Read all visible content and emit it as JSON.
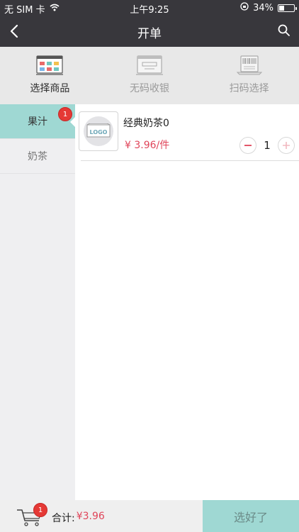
{
  "status_bar": {
    "carrier": "无 SIM 卡",
    "time": "上午9:25",
    "battery": "34%",
    "battery_level": 0.34
  },
  "nav": {
    "title": "开单"
  },
  "modes": [
    {
      "label": "选择商品",
      "icon": "product-grid-icon",
      "active": true
    },
    {
      "label": "无码收银",
      "icon": "cash-register-icon",
      "active": false
    },
    {
      "label": "扫码选择",
      "icon": "barcode-scanner-icon",
      "active": false
    }
  ],
  "categories": [
    {
      "label": "果汁",
      "badge": "1",
      "active": true
    },
    {
      "label": "奶茶",
      "badge": "",
      "active": false
    }
  ],
  "products": [
    {
      "name": "经典奶茶0",
      "price": "¥ 3.96/件",
      "quantity": "1",
      "image_text": "LOGO"
    }
  ],
  "bottom_bar": {
    "cart_badge": "1",
    "total_label": "合计:",
    "total_amount": "¥3.96",
    "confirm_label": "选好了"
  },
  "colors": {
    "accent": "#9fd8d3",
    "price": "#e0455a",
    "header": "#38373c",
    "badge": "#e53935"
  }
}
